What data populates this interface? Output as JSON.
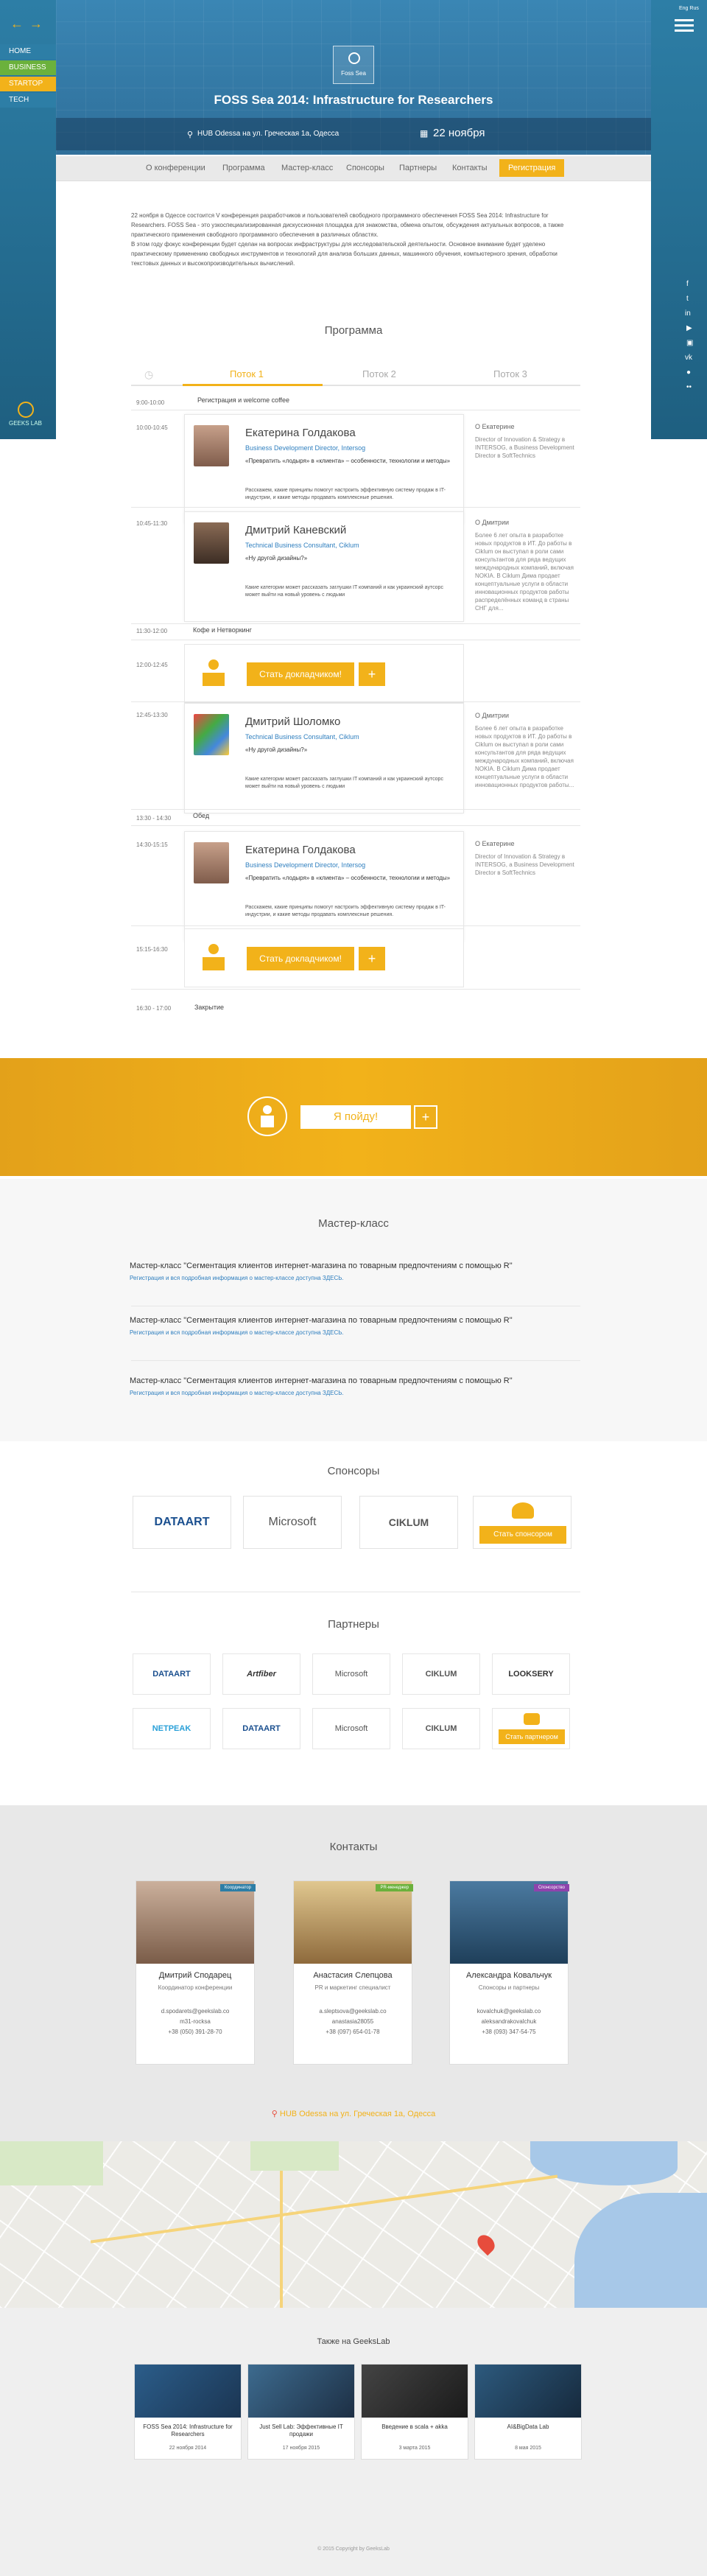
{
  "lang": "Eng  Rus",
  "sidebar": {
    "items": [
      "HOME",
      "BUSINESS",
      "STARTOP",
      "TECH"
    ],
    "logo_text": "GEEKS LAB"
  },
  "hero": {
    "badge": "Foss Sea",
    "title": "FOSS Sea 2014: Infrastructure for Researchers",
    "location": "HUB Odessa на  ул. Греческая 1а, Одесса",
    "date": "22 ноября"
  },
  "nav": [
    "О конференции",
    "Программа",
    "Мастер-класс",
    "Спонсоры",
    "Партнеры",
    "Контакты",
    "Регистрация"
  ],
  "intro": {
    "p1": "22 ноября в Одессе состоится V конференция разработчиков и пользователей свободного программного обеспечения FOSS Sea 2014: Infrastructure for Researchers. FOSS Sea - это узкоспециализированная  дискуссионная площадка для знакомства, обмена опытом, обсуждения актуальных вопросов, а также практического применения свободного программного обеспечения в различных областях.",
    "p2": "В этом году фокус конференции будет сделан на вопросах инфраструктуры для исследовательской деятельности. Основное внимание будет уделено практическому применению свободных инструментов и технологий для анализа больших данных, машинного обучения, компьютерного зрения, обработки текстовых данных и высокопроизводительных вычислений."
  },
  "program": {
    "heading": "Программа",
    "tabs": [
      "Поток 1",
      "Поток 2",
      "Поток 3"
    ],
    "slots": [
      {
        "time": "9:00-10:00",
        "text": "Регистрация и welcome coffee"
      },
      {
        "time": "10:00-10:45",
        "name": "Екатерина Голдакова",
        "role": "Business Development Director, Intersog",
        "title": "«Превратить «лодыря» в «клиента» – особенности, технологии и методы»",
        "desc": "Расскажем, какие принципы помогут настроить эффективную систему продаж в IT-индустрии, и какие методы продавать комплексные решения.",
        "about_title": "О Екатерине",
        "about": "Director of Innovation & Strategy в INTERSOG, a Business Development Director в SoftTechnics"
      },
      {
        "time": "10:45-11:30",
        "name": "Дмитрий Каневский",
        "role": "Technical Business Consultant, Ciklum",
        "title": "«Ну другой дизайны?»",
        "desc": "Какие категории может рассказать заглушки IT компаний и как украинский аутсорс может выйти на новый уровень с людьми",
        "about_title": "О Дмитрии",
        "about": "Более 6 лет опыта в разработке новых продуктов в ИТ. До работы в Ciklum он выступал в роли сами консультантов для ряда ведущих международных компаний, включая NOKIA. В Ciklum Дима продает концептуальные услуги в области инновационных продуктов работы распределённых команд в страны СНГ для..."
      },
      {
        "time": "11:30-12:00",
        "text": "Кофе и Нетворкинг"
      },
      {
        "time": "12:00-12:45",
        "cta": "Стать докладчиком!"
      },
      {
        "time": "12:45-13:30",
        "name": "Дмитрий Шоломко",
        "role": "Technical Business Consultant, Ciklum",
        "title": "«Ну другой дизайны?»",
        "desc": "Какие категории может рассказать заглушки IT компаний и как украинский аутсорс может выйти на новый уровень с людьми",
        "about_title": "О Дмитрии",
        "about": "Более 6 лет опыта в разработке новых продуктов в ИТ. До работы в Ciklum он выступал в роли сами консультантов для ряда ведущих международных компаний, включая NOKIA. В Ciklum Дима продает концептуальные услуги в области инновационных продуктов работы..."
      },
      {
        "time": "13:30 - 14:30",
        "text": "Обед"
      },
      {
        "time": "14:30-15:15",
        "name": "Екатерина Голдакова",
        "role": "Business Development Director, Intersog",
        "title": "«Превратить «лодыря» в «клиента» – особенности, технологии и методы»",
        "desc": "Расскажем, какие принципы помогут настроить эффективную систему продаж в IT-индустрии, и какие методы продавать комплексные решения.",
        "about_title": "О Екатерине",
        "about": "Director of Innovation & Strategy в INTERSOG, a Business Development Director в SoftTechnics"
      },
      {
        "time": "15:15-16:30",
        "cta": "Стать докладчиком!"
      },
      {
        "time": "16:30 - 17:00",
        "text": "Закрытие"
      }
    ]
  },
  "going": {
    "label": "Я пойду!"
  },
  "master": {
    "heading": "Мастер-класс",
    "items": [
      {
        "title": "Мастер-класс  \"Сегментация клиентов интернет-магазина по товарным предпочтениям с помощью R\"",
        "sub": "Регистрация и вся подробная информация о мастер-классе доступна ЗДЕСЬ."
      },
      {
        "title": "Мастер-класс  \"Сегментация клиентов интернет-магазина по товарным предпочтениям с помощью R\"",
        "sub": "Регистрация и вся подробная информация о мастер-классе доступна ЗДЕСЬ."
      },
      {
        "title": "Мастер-класс  \"Сегментация клиентов интернет-магазина по товарным предпочтениям с помощью R\"",
        "sub": "Регистрация и вся подробная информация о мастер-классе доступна ЗДЕСЬ."
      }
    ]
  },
  "sponsors": {
    "heading": "Спонсоры",
    "logos": [
      "DATAART",
      "Microsoft",
      "CIKLUM"
    ],
    "cta": "Стать спонсором"
  },
  "partners": {
    "heading": "Партнеры",
    "row1": [
      "DATAART",
      "Artfiber",
      "Microsoft",
      "CIKLUM",
      "LOOKSERY"
    ],
    "row2": [
      "NETPEAK",
      "DATAART",
      "Microsoft",
      "CIKLUM"
    ],
    "cta": "Стать партнером"
  },
  "contacts": {
    "heading": "Контакты",
    "people": [
      {
        "name": "Дмитрий Сподарец",
        "role": "Координатор конференции",
        "email": "d.spodarets@geekslab.co",
        "skype": "m31-rocksa",
        "phone": "+38 (050) 391-28-70",
        "badge": "Координатор"
      },
      {
        "name": "Анастасия Слепцова",
        "role": "PR и маркетинг специалист",
        "email": "a.sleptsova@geekslab.co",
        "skype": "anastasia28055",
        "phone": "+38 (097) 654-01-78",
        "badge": "PR-менеджер"
      },
      {
        "name": "Александра Ковальчук",
        "role": "Спонсоры и партнеры",
        "email": "kovalchuk@geekslab.co",
        "skype": "aleksandrakovalchuk",
        "phone": "+38 (093) 347-54-75",
        "badge": "Спонсорство"
      }
    ],
    "address": "HUB Odessa на  ул. Греческая 1а, Одесса"
  },
  "also": {
    "heading": "Также на GeeksLab",
    "events": [
      {
        "title": "FOSS Sea 2014: Infrastructure for Researchers",
        "date": "22 ноября 2014"
      },
      {
        "title": "Just Sell Lab: Эффективные IT продажи",
        "date": "17 ноября 2015"
      },
      {
        "title": "Введение в scala + akka",
        "date": "3 марта 2015"
      },
      {
        "title": "AI&BigData Lab",
        "date": "8 мая 2015"
      }
    ]
  },
  "footer": "© 2015 Copyright by GeeksLab",
  "colors": {
    "accent": "#f2b21a",
    "blue": "#2d7ea6"
  }
}
